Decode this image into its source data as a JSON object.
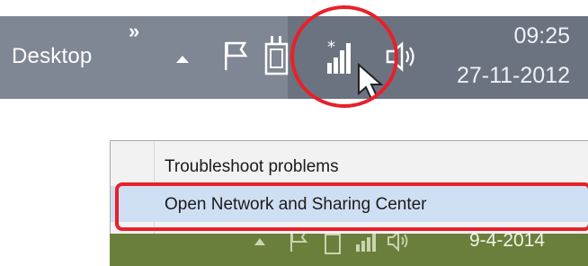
{
  "top_taskbar": {
    "desktop_label": "Desktop",
    "chevron": "»",
    "clock_time": "09:25",
    "clock_date": "27-11-2012",
    "icons": [
      "show-hidden-icons-arrow-icon",
      "action-center-flag-icon",
      "power-plug-icon",
      "network-signal-icon",
      "mouse-cursor-icon",
      "speaker-volume-icon"
    ]
  },
  "context_menu": {
    "items": [
      {
        "label": "Troubleshoot problems"
      },
      {
        "label": "Open Network and Sharing Center"
      }
    ]
  },
  "bottom_taskbar": {
    "clock_date": "9-4-2014"
  },
  "colors": {
    "highlight": "#e8202a",
    "taskbar_gray": "#7f8794",
    "taskbar_green": "#6b7f3c",
    "menu_selected": "#cfdff3"
  }
}
